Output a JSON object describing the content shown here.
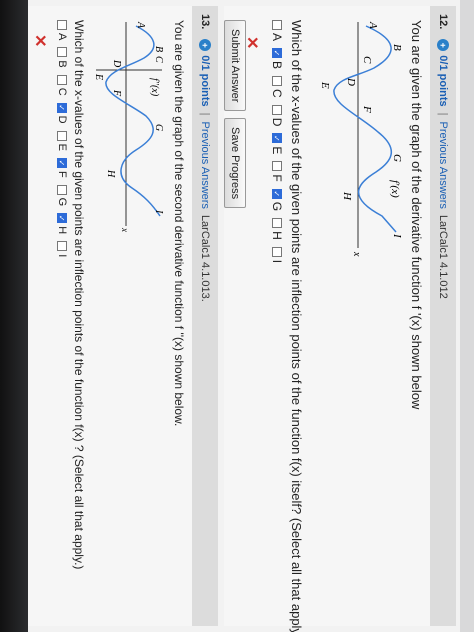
{
  "questions": [
    {
      "number": "12.",
      "points": "0/1 points",
      "previous": "Previous Answers",
      "code": "LarCalc1 4.1.012",
      "prompt": "You are given the graph of the derivative function f '(x) shown below",
      "graph_label": "f'(x)",
      "graph_points": [
        "A",
        "B",
        "C",
        "D",
        "E",
        "F",
        "G",
        "H",
        "I"
      ],
      "question": "Which of the x-values of the given points are inflection points of the function f(x) itself? (Select all that apply.)",
      "choices": [
        {
          "label": "A",
          "checked": false
        },
        {
          "label": "B",
          "checked": true
        },
        {
          "label": "C",
          "checked": false
        },
        {
          "label": "D",
          "checked": false
        },
        {
          "label": "E",
          "checked": true
        },
        {
          "label": "F",
          "checked": false
        },
        {
          "label": "G",
          "checked": true
        },
        {
          "label": "H",
          "checked": false
        },
        {
          "label": "I",
          "checked": false
        }
      ],
      "submit": "Submit Answer",
      "save": "Save Progress"
    },
    {
      "number": "13.",
      "points": "0/1 points",
      "previous": "Previous Answers",
      "code": "LarCalc1 4.1.013.",
      "prompt": "You are given the graph of the second derivative function f ''(x) shown below.",
      "graph_label": "f''(x)",
      "graph_points": [
        "A",
        "B",
        "C",
        "D",
        "E",
        "F",
        "G",
        "H",
        "I"
      ],
      "question": "Which of the x-values of the given points are inflection points of the function f(x) ? (Select all that apply.)",
      "choices": [
        {
          "label": "A",
          "checked": false
        },
        {
          "label": "B",
          "checked": false
        },
        {
          "label": "C",
          "checked": false
        },
        {
          "label": "D",
          "checked": true
        },
        {
          "label": "E",
          "checked": false
        },
        {
          "label": "F",
          "checked": true
        },
        {
          "label": "G",
          "checked": false
        },
        {
          "label": "H",
          "checked": true
        },
        {
          "label": "I",
          "checked": false
        }
      ]
    }
  ],
  "marks": {
    "incorrect": "✕"
  },
  "colors": {
    "accent": "#2a80c9",
    "curve": "#3b7fd6",
    "incorrect": "#d0312d"
  }
}
